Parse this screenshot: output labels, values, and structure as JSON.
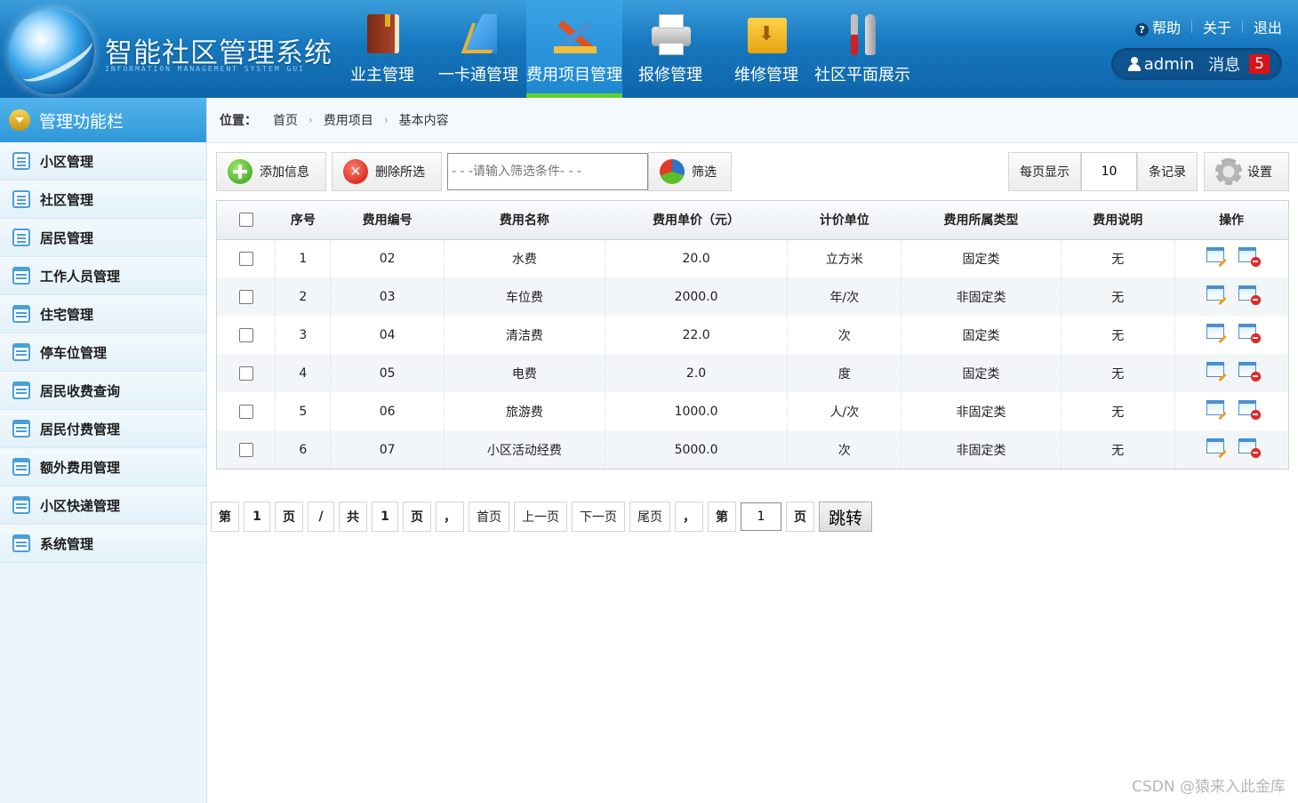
{
  "app": {
    "title": "智能社区管理系统",
    "subtitle": "INFORMATION MANAGEMENT SYSTEM GUI"
  },
  "topnav": {
    "items": [
      {
        "label": "业主管理",
        "icon": "book-icon"
      },
      {
        "label": "一卡通管理",
        "icon": "ruler-icon"
      },
      {
        "label": "费用项目管理",
        "icon": "tools-icon",
        "active": true
      },
      {
        "label": "报修管理",
        "icon": "printer-icon"
      },
      {
        "label": "维修管理",
        "icon": "download-box-icon"
      },
      {
        "label": "社区平面展示",
        "icon": "screwdriver-wrench-icon"
      }
    ]
  },
  "toplinks": {
    "help": "帮助",
    "about": "关于",
    "logout": "退出"
  },
  "user": {
    "name": "admin",
    "messages_label": "消息",
    "messages_count": "5"
  },
  "sidebar": {
    "title": "管理功能栏",
    "items": [
      {
        "label": "小区管理"
      },
      {
        "label": "社区管理"
      },
      {
        "label": "居民管理"
      },
      {
        "label": "工作人员管理"
      },
      {
        "label": "住宅管理"
      },
      {
        "label": "停车位管理"
      },
      {
        "label": "居民收费查询"
      },
      {
        "label": "居民付费管理"
      },
      {
        "label": "额外费用管理"
      },
      {
        "label": "小区快递管理"
      },
      {
        "label": "系统管理"
      }
    ]
  },
  "breadcrumb": {
    "label": "位置：",
    "items": [
      "首页",
      "费用项目",
      "基本内容"
    ]
  },
  "toolbar": {
    "add_label": "添加信息",
    "delete_label": "删除所选",
    "filter_placeholder": "- - -请输入筛选条件- - -",
    "filter_label": "筛选",
    "perpage_label": "每页显示",
    "perpage_value": "10",
    "records_label": "条记录",
    "settings_label": "设置"
  },
  "table": {
    "columns": [
      "序号",
      "费用编号",
      "费用名称",
      "费用单价（元）",
      "计价单位",
      "费用所属类型",
      "费用说明",
      "操作"
    ],
    "rows": [
      [
        "1",
        "02",
        "水费",
        "20.0",
        "立方米",
        "固定类",
        "无"
      ],
      [
        "2",
        "03",
        "车位费",
        "2000.0",
        "年/次",
        "非固定类",
        "无"
      ],
      [
        "3",
        "04",
        "清洁费",
        "22.0",
        "次",
        "固定类",
        "无"
      ],
      [
        "4",
        "05",
        "电费",
        "2.0",
        "度",
        "固定类",
        "无"
      ],
      [
        "5",
        "06",
        "旅游费",
        "1000.0",
        "人/次",
        "非固定类",
        "无"
      ],
      [
        "6",
        "07",
        "小区活动经费",
        "5000.0",
        "次",
        "非固定类",
        "无"
      ]
    ]
  },
  "pager": {
    "di": "第",
    "page": "1",
    "ye": "页",
    "slash": "/",
    "gong": "共",
    "total": "1",
    "ye2": "页",
    "comma": "，",
    "first": "首页",
    "prev": "上一页",
    "next": "下一页",
    "last": "尾页",
    "comma2": "，",
    "di2": "第",
    "jump_value": "1",
    "ye3": "页",
    "go": "跳转"
  },
  "watermark": "CSDN @猿来入此金库",
  "colors": {
    "header": "#1778bf",
    "active_tab": "#2a95dc",
    "active_underline": "#5fd12e",
    "badge": "#d8141a",
    "sidebar_bg": "#eaf5fb"
  }
}
